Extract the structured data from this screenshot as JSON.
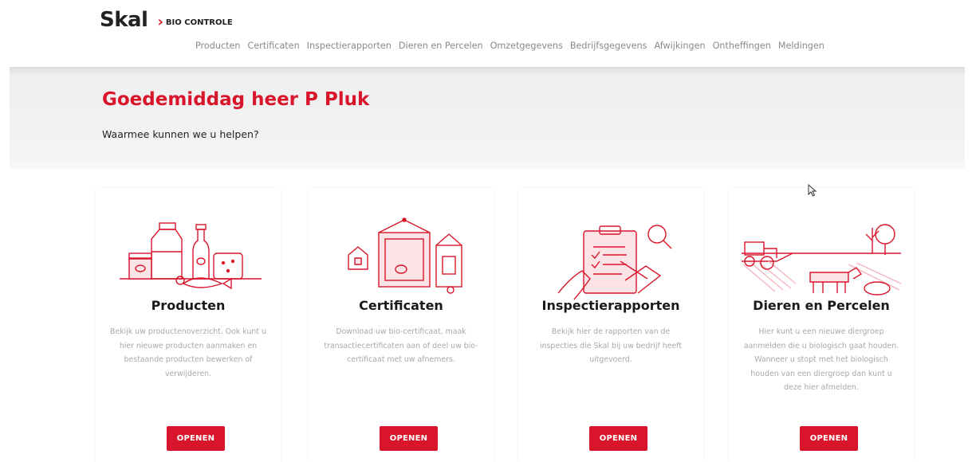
{
  "logo": {
    "brand": "Skal",
    "chevron": "›",
    "subtitle": "BIO CONTROLE"
  },
  "nav": {
    "items": [
      {
        "label": "Producten"
      },
      {
        "label": "Certificaten"
      },
      {
        "label": "Inspectierapporten"
      },
      {
        "label": "Dieren en Percelen"
      },
      {
        "label": "Omzetgegevens"
      },
      {
        "label": "Bedrijfsgegevens"
      },
      {
        "label": "Afwijkingen"
      },
      {
        "label": "Ontheffingen"
      },
      {
        "label": "Meldingen"
      }
    ]
  },
  "hero": {
    "greeting": "Goedemiddag heer P Pluk",
    "question": "Waarmee kunnen we u helpen?"
  },
  "cards": [
    {
      "title": "Producten",
      "description": "Bekijk uw productenoverzicht. Ook kunt u hier nieuwe producten aanmaken en bestaande producten bewerken of verwijderen.",
      "button": "OPENEN",
      "icon": "products-illustration"
    },
    {
      "title": "Certificaten",
      "description": "Download uw bio-certificaat, maak transactiecertificaten aan of deel uw bio-certificaat met uw afnemers.",
      "button": "OPENEN",
      "icon": "certificates-illustration"
    },
    {
      "title": "Inspectierapporten",
      "description": "Bekijk hier de rapporten van de inspecties die Skal bij uw bedrijf heeft uitgevoerd.",
      "button": "OPENEN",
      "icon": "inspection-illustration"
    },
    {
      "title": "Dieren en Percelen",
      "description": "Hier kunt u een nieuwe diergroep aanmelden die u biologisch gaat houden.\nWanneer u stopt met het biologisch houden van een diergroep dan kunt u deze hier afmelden.",
      "button": "OPENEN",
      "icon": "farm-illustration"
    }
  ],
  "colors": {
    "accent": "#d9152b",
    "text": "#1a1a1a",
    "muted": "#a9a9a9",
    "nav": "#8a8a8a"
  }
}
